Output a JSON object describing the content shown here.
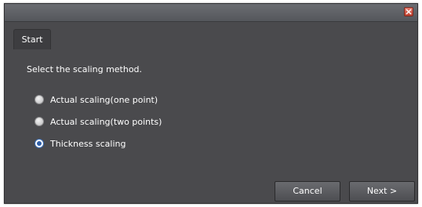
{
  "window": {
    "close_icon": "close-icon"
  },
  "tab": {
    "label": "Start"
  },
  "content": {
    "instruction": "Select the scaling method.",
    "options": [
      {
        "label": "Actual scaling(one point)",
        "selected": false
      },
      {
        "label": "Actual scaling(two points)",
        "selected": false
      },
      {
        "label": "Thickness scaling",
        "selected": true
      }
    ]
  },
  "buttons": {
    "cancel": "Cancel",
    "next": "Next >"
  },
  "colors": {
    "window_bg": "#4a4a4d",
    "selected_radio": "#2f5fa8",
    "close_button": "#c0412f"
  }
}
